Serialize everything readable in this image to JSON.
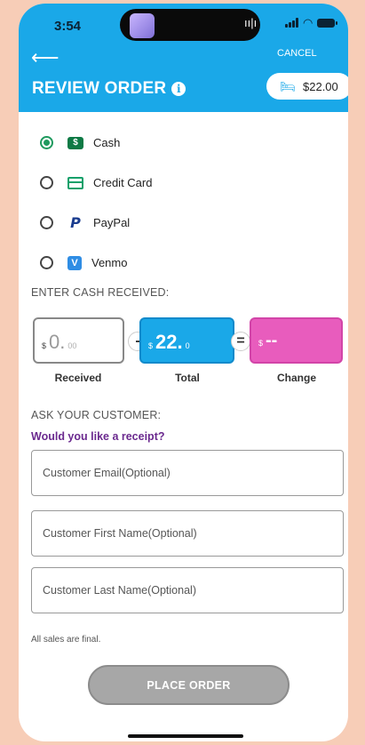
{
  "status": {
    "time": "3:54"
  },
  "header": {
    "back_icon": "arrow-left-icon",
    "cancel_label": "CANCEL",
    "title": "REVIEW ORDER",
    "info_icon": "info-icon",
    "cart_icon": "bed-icon",
    "total": "$22.00"
  },
  "payment_methods": [
    {
      "label": "Cash",
      "icon": "cash-icon",
      "selected": true
    },
    {
      "label": "Credit Card",
      "icon": "credit-card-icon",
      "selected": false
    },
    {
      "label": "PayPal",
      "icon": "paypal-icon",
      "selected": false
    },
    {
      "label": "Venmo",
      "icon": "venmo-icon",
      "selected": false
    }
  ],
  "cash": {
    "section_label": "ENTER CASH RECEIVED:",
    "received": {
      "currency": "$",
      "whole": "0.",
      "cents": "00",
      "caption": "Received"
    },
    "minus": "-",
    "total": {
      "currency": "$",
      "whole": "22.",
      "cents": "0",
      "caption": "Total"
    },
    "equals": "=",
    "change": {
      "currency": "$",
      "value": "--",
      "caption": "Change"
    }
  },
  "customer": {
    "section_label": "ASK YOUR CUSTOMER:",
    "receipt_question": "Would you like a receipt?",
    "email_placeholder": "Customer Email(Optional)",
    "first_name_placeholder": "Customer First Name(Optional)",
    "last_name_placeholder": "Customer Last Name(Optional)"
  },
  "footer": {
    "note": "All sales are final.",
    "place_order_label": "PLACE ORDER"
  },
  "colors": {
    "header_blue": "#1aa8e8",
    "total_blue": "#1aa8e8",
    "change_pink": "#e85cbd",
    "receipt_purple": "#6b2a8f",
    "cash_green": "#1f9a5e",
    "background_peach": "#f7cdb7"
  }
}
